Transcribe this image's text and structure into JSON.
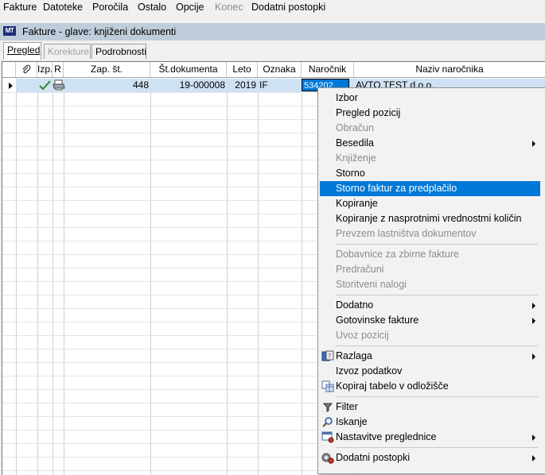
{
  "menubar": [
    "Fakture",
    "Datoteke",
    "Poročila",
    "Ostalo",
    "Opcije",
    "Konec",
    "Dodatni postopki"
  ],
  "window": {
    "logo": "MT",
    "title": "Fakture - glave: knjiženi dokumenti"
  },
  "tabs": [
    "Pregled",
    "Korekture",
    "Podrobnosti"
  ],
  "grid": {
    "columns": [
      "",
      "Izp.",
      "R",
      "Zap. št.",
      "Št.dokumenta",
      "Leto",
      "Oznaka",
      "Naročnik",
      "Naziv naročnika"
    ],
    "row": {
      "zap_st": "448",
      "st_dokumenta": "19-000008",
      "leto": "2019",
      "oznaka": "IF",
      "narocnik": "534202",
      "naziv": "AVTO TEST d.o.o."
    }
  },
  "context_menu": {
    "items": [
      {
        "label": "Izbor"
      },
      {
        "label": "Pregled pozicij"
      },
      {
        "label": "Obračun",
        "disabled": true
      },
      {
        "label": "Besedila",
        "submenu": true
      },
      {
        "label": "Knjiženje",
        "disabled": true
      },
      {
        "label": "Storno"
      },
      {
        "label": "Storno faktur za predplačilo",
        "highlighted": true
      },
      {
        "label": "Kopiranje"
      },
      {
        "label": "Kopiranje z nasprotnimi vrednostmi količin"
      },
      {
        "label": "Prevzem lastništva dokumentov",
        "disabled": true
      },
      {
        "label": "Dobavnice za zbirne fakture",
        "disabled": true
      },
      {
        "label": "Predračuni",
        "disabled": true
      },
      {
        "label": "Storitveni nalogi",
        "disabled": true
      },
      {
        "label": "Dodatno",
        "submenu": true
      },
      {
        "label": "Gotovinske fakture",
        "submenu": true
      },
      {
        "label": "Uvoz pozicij",
        "disabled": true
      },
      {
        "label": "Razlaga",
        "submenu": true,
        "icon": "help-book-icon"
      },
      {
        "label": "Izvoz podatkov"
      },
      {
        "label": "Kopiraj tabelo v odložišče",
        "icon": "copy-table-icon"
      },
      {
        "label": "Filter",
        "icon": "filter-icon"
      },
      {
        "label": "Iskanje",
        "icon": "search-icon"
      },
      {
        "label": "Nastavitve preglednice",
        "submenu": true,
        "icon": "grid-settings-icon"
      },
      {
        "label": "Dodatni postopki",
        "submenu": true,
        "icon": "gears-icon"
      }
    ]
  },
  "colors": {
    "highlight": "#0078d7",
    "caption": "#bfcddb",
    "selected_row": "#cfe2f3"
  }
}
